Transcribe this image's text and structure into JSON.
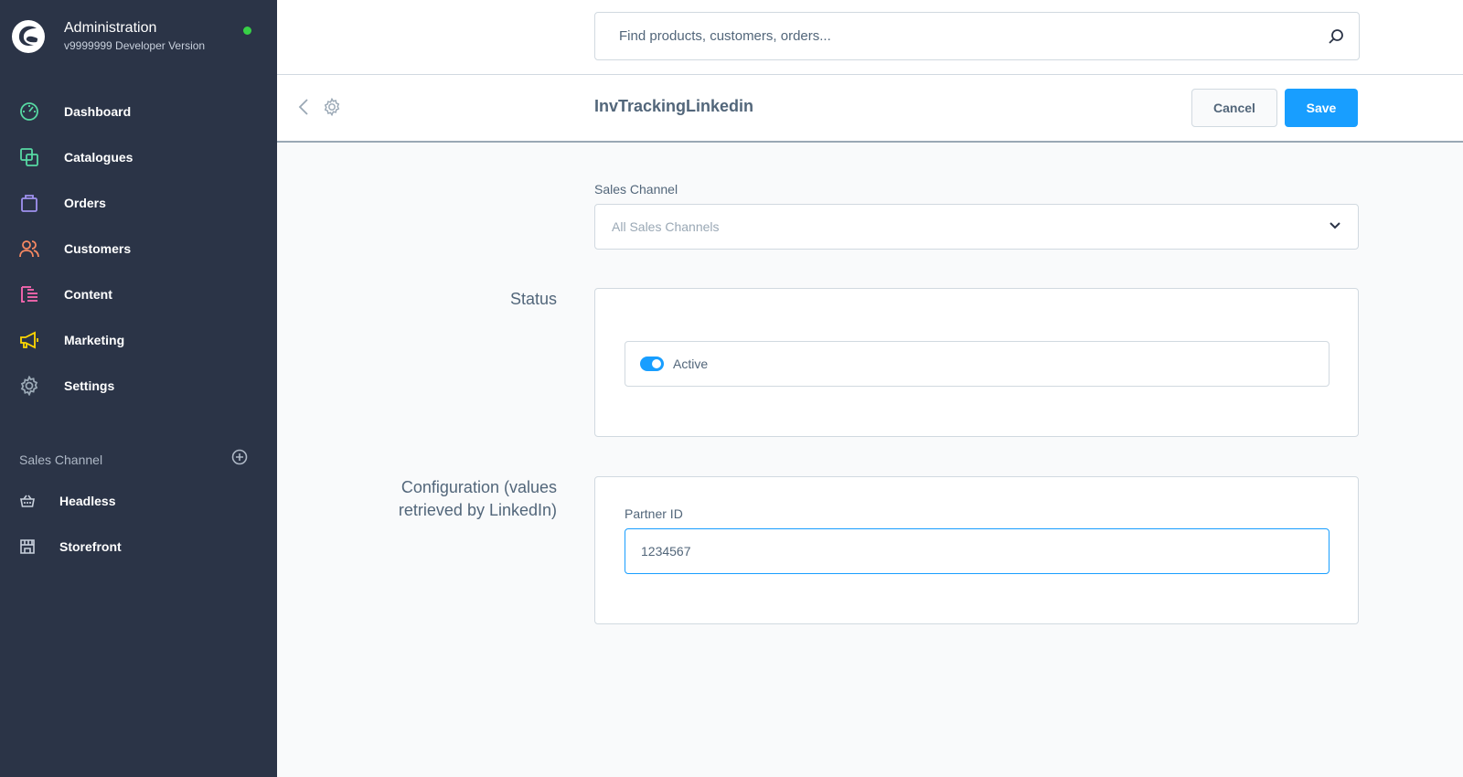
{
  "app": {
    "title": "Administration",
    "version": "v9999999 Developer Version",
    "status_color": "#37d046"
  },
  "sidebar": {
    "items": [
      {
        "label": "Dashboard",
        "icon": "dashboard-icon",
        "color": "#57d9a3"
      },
      {
        "label": "Catalogues",
        "icon": "catalogue-icon",
        "color": "#57d9a3"
      },
      {
        "label": "Orders",
        "icon": "orders-bag-icon",
        "color": "#a092f0"
      },
      {
        "label": "Customers",
        "icon": "customers-icon",
        "color": "#f88962"
      },
      {
        "label": "Content",
        "icon": "content-icon",
        "color": "#ff68b4"
      },
      {
        "label": "Marketing",
        "icon": "megaphone-icon",
        "color": "#ffd700"
      },
      {
        "label": "Settings",
        "icon": "gear-icon",
        "color": "#9aa8b5"
      }
    ],
    "sales_channel_header": "Sales Channel",
    "sales_channels": [
      {
        "label": "Headless",
        "icon": "basket-icon"
      },
      {
        "label": "Storefront",
        "icon": "storefront-icon"
      }
    ]
  },
  "search": {
    "placeholder": "Find products, customers, orders..."
  },
  "smartbar": {
    "title": "InvTrackingLinkedin",
    "cancel_label": "Cancel",
    "save_label": "Save"
  },
  "form": {
    "sales_channel_label": "Sales Channel",
    "sales_channel_value": "All Sales Channels",
    "status_title": "Status",
    "active_label": "Active",
    "active_on": true,
    "config_title_line1": "Configuration (values",
    "config_title_line2": "retrieved by LinkedIn)",
    "partner_id_label": "Partner ID",
    "partner_id_value": "1234567"
  },
  "colors": {
    "sidebar_bg": "#2b3447",
    "accent": "#189eff"
  }
}
